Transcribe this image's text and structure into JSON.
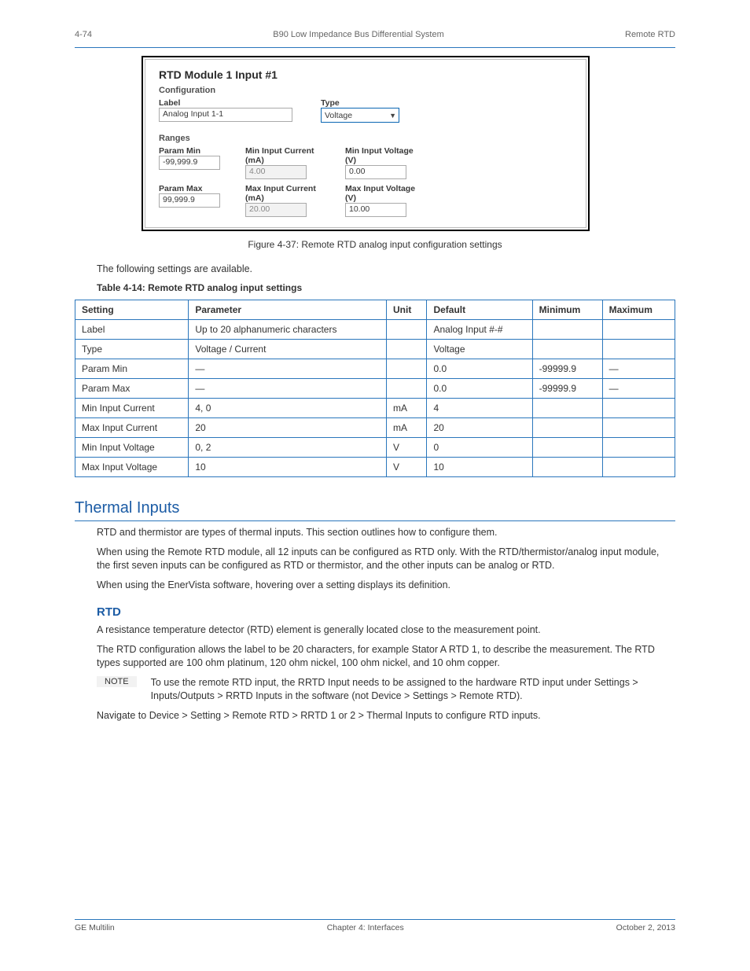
{
  "header": {
    "page_num": "4-74",
    "chapter": "B90 Low Impedance Bus Differential System",
    "section": "Remote RTD"
  },
  "figure": {
    "title": "RTD Module 1 Input #1",
    "configuration_label": "Configuration",
    "label_label": "Label",
    "label_value": "Analog Input 1-1",
    "type_label": "Type",
    "type_value": "Voltage",
    "ranges_label": "Ranges",
    "param_min_label": "Param Min",
    "param_min_value": "-99,999.9",
    "param_max_label": "Param Max",
    "param_max_value": "99,999.9",
    "min_current_label": "Min Input Current (mA)",
    "min_current_value": "4.00",
    "max_current_label": "Max Input Current (mA)",
    "max_current_value": "20.00",
    "min_voltage_label": "Min Input Voltage (V)",
    "min_voltage_value": "0.00",
    "max_voltage_label": "Max Input Voltage (V)",
    "max_voltage_value": "10.00",
    "caption": "Figure 4-37: Remote RTD analog input configuration settings"
  },
  "intro_text": "The following settings are available.",
  "table_caption": "Table 4-14: Remote RTD analog input settings",
  "table": {
    "headers": [
      "Setting",
      "Parameter",
      "Unit",
      "Default",
      "Minimum",
      "Maximum"
    ],
    "rows": [
      [
        "Label",
        "Up to 20 alphanumeric characters",
        "",
        "Analog Input #-#",
        "",
        ""
      ],
      [
        "Type",
        "Voltage / Current",
        "",
        "Voltage",
        "",
        ""
      ],
      [
        "Param Min",
        "—",
        "",
        "0.0",
        "-99999.9",
        "—"
      ],
      [
        "Param Max",
        "—",
        "",
        "0.0",
        "-99999.9",
        "—"
      ],
      [
        "Min Input Current",
        "4, 0",
        "mA",
        "4",
        "",
        ""
      ],
      [
        "Max Input Current",
        "20",
        "mA",
        "20",
        "",
        ""
      ],
      [
        "Min Input Voltage",
        "0, 2",
        "V",
        "0",
        "",
        ""
      ],
      [
        "Max Input Voltage",
        "10",
        "V",
        "10",
        "",
        ""
      ]
    ]
  },
  "section_heading": "Thermal Inputs",
  "thermal_intro_1": "RTD and thermistor are types of thermal inputs. This section outlines how to configure them.",
  "thermal_intro_2": "When using the Remote RTD module, all 12 inputs can be configured as RTD only. With the RTD/thermistor/analog input module, the first seven inputs can be configured as RTD or thermistor, and the other inputs can be analog or RTD.",
  "thermal_intro_3": "When using the EnerVista software, hovering over a setting displays its definition.",
  "sub_heading": "RTD",
  "rtd_text_1": "A resistance temperature detector (RTD) element is generally located close to the measurement point.",
  "rtd_text_2": "The RTD configuration allows the label to be 20 characters, for example Stator A RTD 1, to describe the measurement. The RTD types supported are 100 ohm platinum, 120 ohm nickel, 100 ohm nickel, and 10 ohm copper.",
  "note_text": "To use the remote RTD input, the RRTD Input needs to be assigned to the hardware RTD input under Settings > Inputs/Outputs > RRTD Inputs in the software (not Device > Settings > Remote RTD).",
  "rtd_text_3": "Navigate to Device > Setting > Remote RTD > RRTD 1 or 2 > Thermal Inputs to configure RTD inputs.",
  "note_label": "NOTE",
  "footer": {
    "left": "GE Multilin",
    "center": "Chapter 4: Interfaces",
    "right": "October 2, 2013"
  }
}
